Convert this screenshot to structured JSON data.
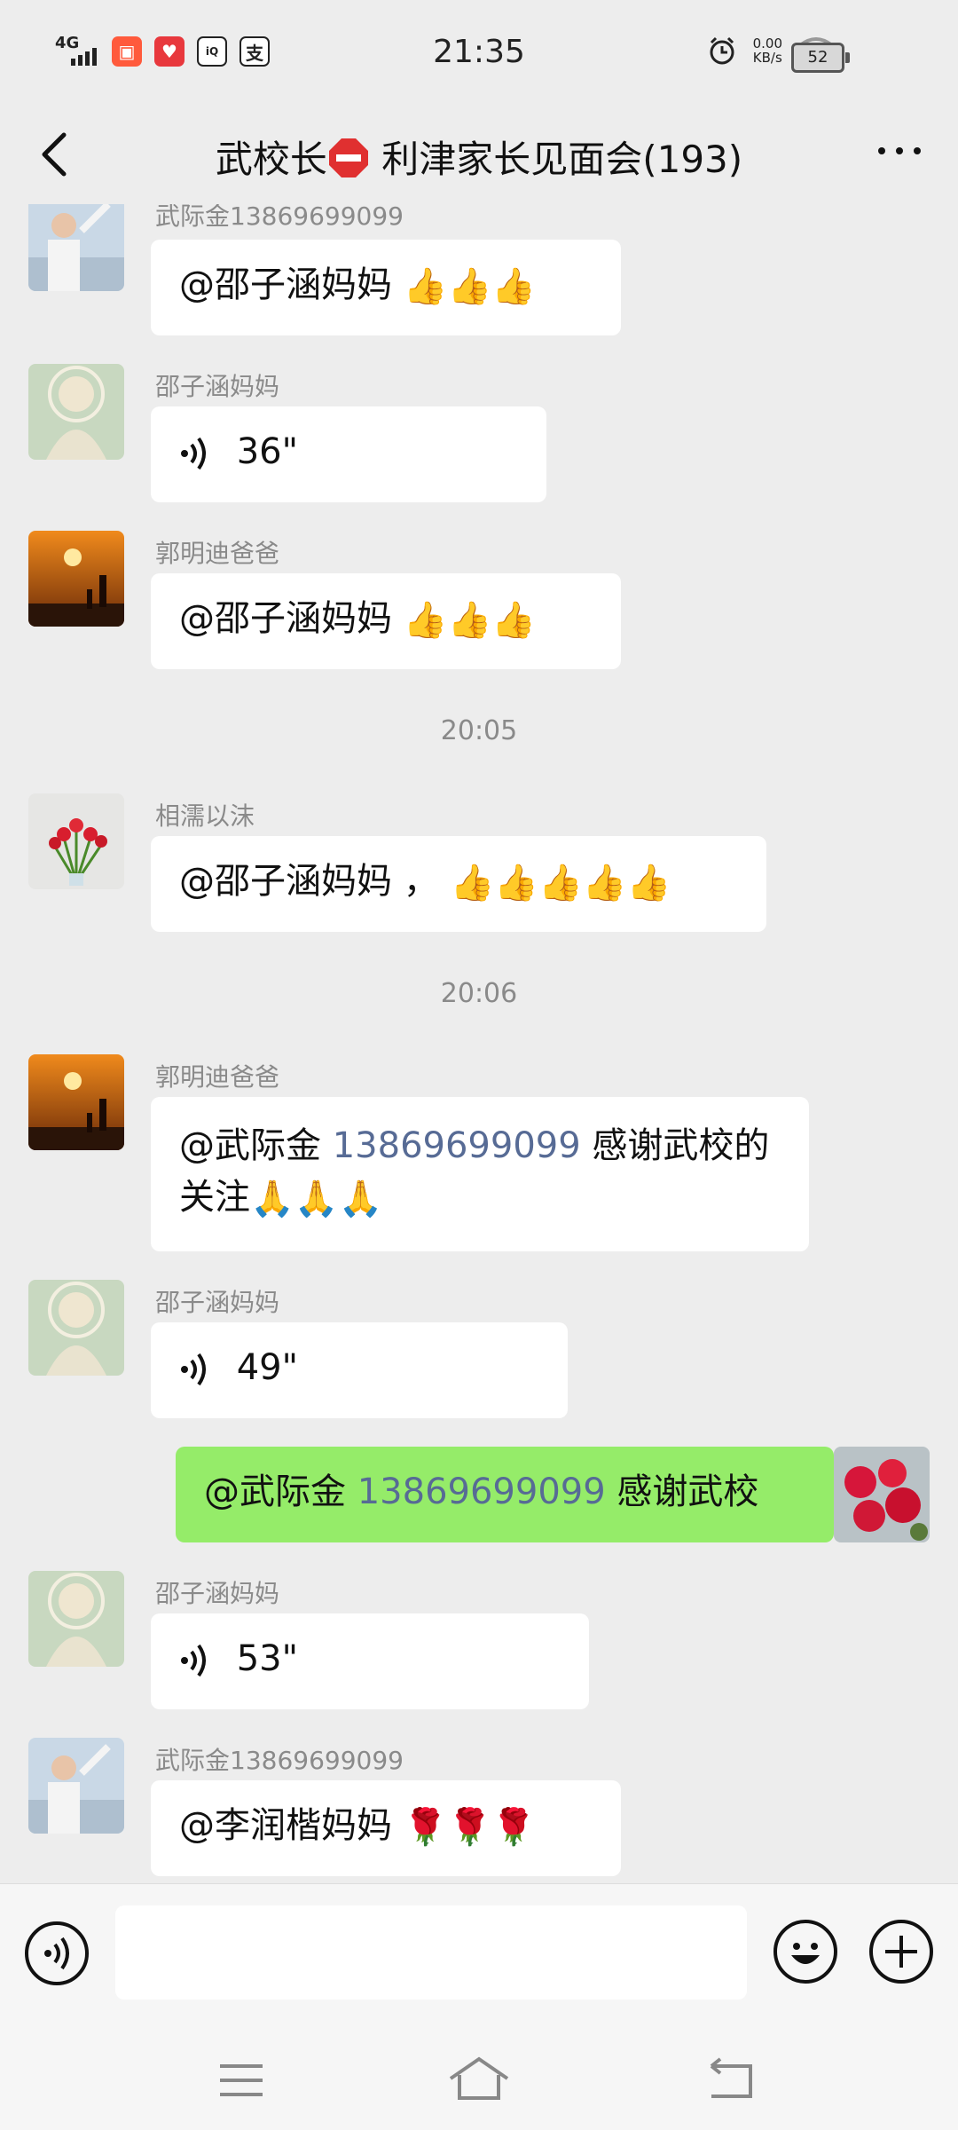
{
  "status_bar": {
    "network": "4G",
    "time": "21:35",
    "speed_value": "0.00",
    "speed_unit": "KB/s",
    "battery": "52"
  },
  "header": {
    "title_prefix": "武校长",
    "title_suffix": "利津家长见面会(193)"
  },
  "messages": [
    {
      "sender": "武际金13869699099",
      "mention": "@邵子涵妈妈",
      "emoji": "👍👍👍"
    },
    {
      "sender": "邵子涵妈妈",
      "voice_duration": "36\""
    },
    {
      "sender": "郭明迪爸爸",
      "mention": "@邵子涵妈妈",
      "emoji": "👍👍👍"
    },
    {
      "time_separator": "20:05"
    },
    {
      "sender": "相濡以沫",
      "mention": "@邵子涵妈妈",
      "text": "，",
      "emoji": "👍👍👍👍👍"
    },
    {
      "time_separator": "20:06"
    },
    {
      "sender": "郭明迪爸爸",
      "mention": "@武际金",
      "mention_number": "13869699099",
      "text": "感谢武校的关注",
      "emoji": "🙏🙏🙏"
    },
    {
      "sender": "邵子涵妈妈",
      "voice_duration": "49\""
    },
    {
      "mine": true,
      "mention": "@武际金",
      "mention_number": "13869699099",
      "text": "感谢武校"
    },
    {
      "sender": "邵子涵妈妈",
      "voice_duration": "53\""
    },
    {
      "sender": "武际金13869699099",
      "mention": "@李润楷妈妈",
      "emoji": "🌹🌹🌹"
    }
  ],
  "icons": {
    "back": "chevron-left-icon",
    "more": "more-dots-icon",
    "voice": "voice-input-icon",
    "emoji": "emoji-icon",
    "plus": "plus-icon",
    "stop": "stop-sign-emoji"
  },
  "colors": {
    "background": "#ededed",
    "bubble_incoming": "#ffffff",
    "bubble_outgoing": "#95ec69",
    "mention": "#576b95"
  }
}
